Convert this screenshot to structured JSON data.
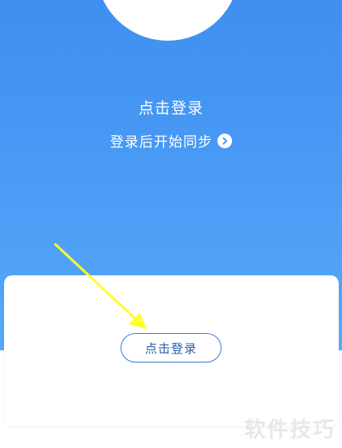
{
  "header": {
    "title": "点击登录",
    "subtitle": "登录后开始同步"
  },
  "card": {
    "login_button_label": "点击登录"
  },
  "watermark": {
    "text": "软件技巧"
  },
  "icons": {
    "avatar": "user-avatar-ring-icon",
    "subtitle_chevron": "chevron-right-circle-icon",
    "annotation_arrow": "yellow-arrow-icon"
  },
  "colors": {
    "hero_top": "#3f8ff0",
    "hero_bottom": "#58aaf9",
    "button_border": "#3a7fd6",
    "arrow": "#ffff2a"
  }
}
